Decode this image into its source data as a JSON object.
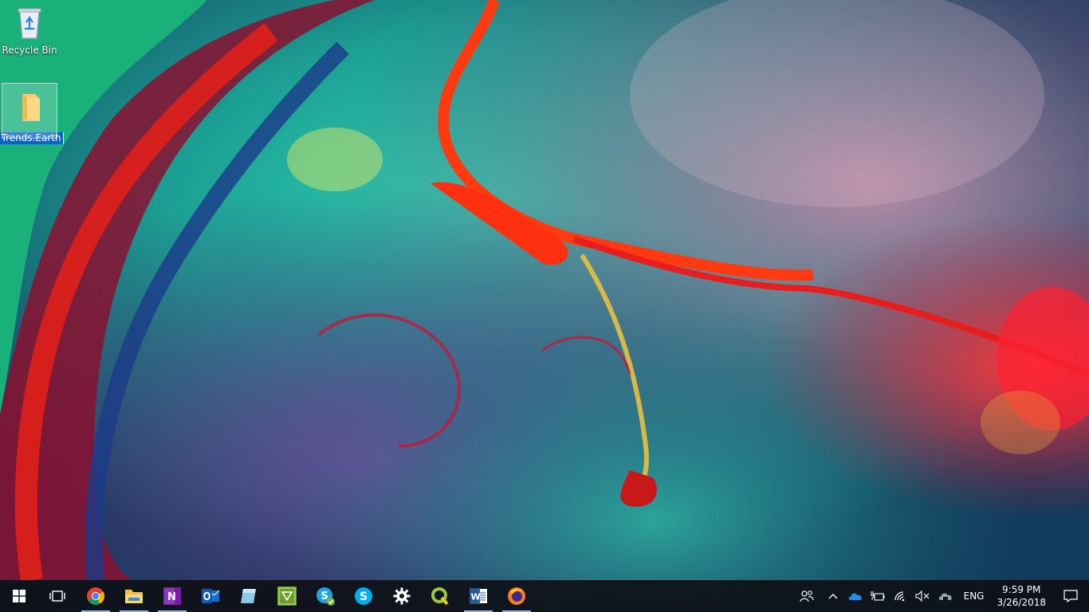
{
  "desktop": {
    "icons": [
      {
        "label": "Recycle Bin",
        "icon": "recycle-bin-icon"
      },
      {
        "label": "Trends.Earth",
        "icon": "folder-icon",
        "selected": true,
        "renaming": true
      }
    ]
  },
  "taskbar": {
    "pinned": [
      {
        "name": "start",
        "icon": "windows-logo-icon",
        "running": false
      },
      {
        "name": "task-view",
        "icon": "task-view-icon",
        "running": false
      },
      {
        "name": "chrome",
        "icon": "chrome-icon",
        "running": true
      },
      {
        "name": "file-explorer",
        "icon": "file-explorer-icon",
        "running": true
      },
      {
        "name": "onenote",
        "icon": "onenote-icon",
        "running": true
      },
      {
        "name": "outlook",
        "icon": "outlook-icon",
        "running": false
      },
      {
        "name": "notepad",
        "icon": "notepad-icon",
        "running": false
      },
      {
        "name": "osgeo",
        "icon": "osgeo-icon",
        "running": false
      },
      {
        "name": "skype-business",
        "icon": "skype-business-icon",
        "running": false
      },
      {
        "name": "skype",
        "icon": "skype-icon",
        "running": false
      },
      {
        "name": "settings",
        "icon": "gear-icon",
        "running": false
      },
      {
        "name": "qgis",
        "icon": "qgis-icon",
        "running": false
      },
      {
        "name": "word",
        "icon": "word-icon",
        "running": true
      },
      {
        "name": "firefox",
        "icon": "firefox-icon",
        "running": true
      }
    ],
    "tray": {
      "language": "ENG",
      "time": "9:59 PM",
      "date": "3/26/2018"
    }
  },
  "colors": {
    "taskbar_bg": "#0e1016",
    "running_indicator": "#8fb8e8",
    "selection_blue": "#0a64c8"
  }
}
